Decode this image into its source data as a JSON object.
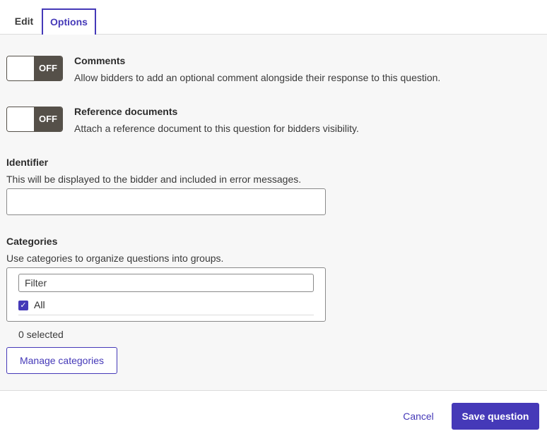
{
  "tabs": [
    {
      "label": "Edit",
      "active": false
    },
    {
      "label": "Options",
      "active": true
    }
  ],
  "options": [
    {
      "toggle_state": "OFF",
      "title": "Comments",
      "description": "Allow bidders to add an optional comment alongside their response to this question."
    },
    {
      "toggle_state": "OFF",
      "title": "Reference documents",
      "description": "Attach a reference document to this question for bidders visibility."
    }
  ],
  "identifier": {
    "title": "Identifier",
    "description": "This will be displayed to the bidder and included in error messages.",
    "value": ""
  },
  "categories": {
    "title": "Categories",
    "description": "Use categories to organize questions into groups.",
    "filter_placeholder": "Filter",
    "all_label": "All",
    "all_checked": true,
    "selected_text": "0 selected",
    "manage_label": "Manage categories"
  },
  "footer": {
    "cancel_label": "Cancel",
    "save_label": "Save question"
  },
  "colors": {
    "accent": "#4539b8",
    "toggle_off": "#555049",
    "panel_bg": "#f7f7f7"
  }
}
